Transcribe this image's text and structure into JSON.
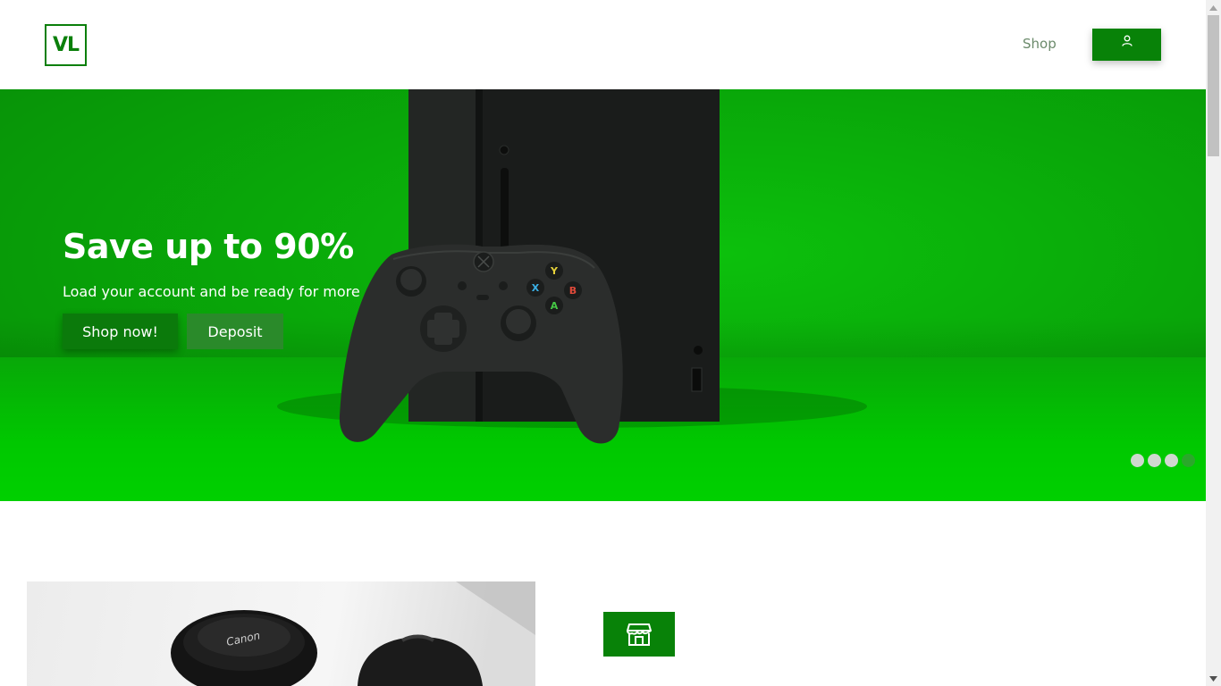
{
  "header": {
    "logo_text": "VL",
    "nav": {
      "shop_label": "Shop"
    },
    "account_icon": "user-icon"
  },
  "hero": {
    "title": "Save up to 90%",
    "subtitle": "Load your account and be ready for more",
    "shop_now_label": "Shop now!",
    "deposit_label": "Deposit",
    "carousel": {
      "total_slides": 4,
      "active_index": 3
    }
  },
  "feature": {
    "store_icon": "store-icon"
  },
  "colors": {
    "brand_green": "#088208",
    "hero_green": "#09a809",
    "white": "#ffffff"
  }
}
